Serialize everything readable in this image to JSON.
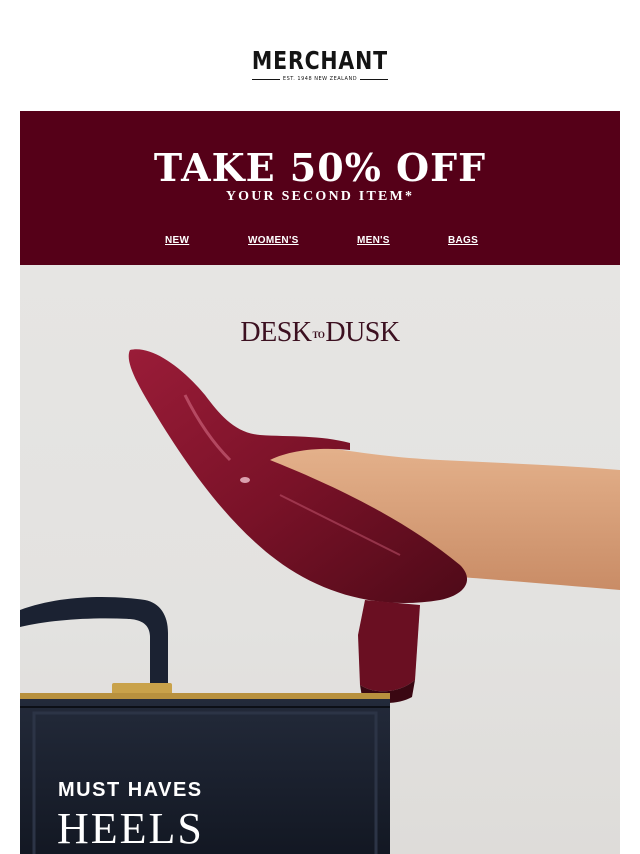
{
  "brand": {
    "logo_text": "MERCHANT",
    "logo_tagline": "EST. 1948 NEW ZEALAND"
  },
  "promo": {
    "headline": "TAKE 50% OFF",
    "subheadline": "YOUR SECOND ITEM*",
    "background_color": "#550018",
    "nav": [
      {
        "label": "NEW"
      },
      {
        "label": "WOMEN'S"
      },
      {
        "label": "MEN'S"
      },
      {
        "label": "BAGS"
      }
    ]
  },
  "hero": {
    "collection_title_left": "DESK",
    "collection_title_connector": "TO",
    "collection_title_right": "DUSK",
    "eyebrow": "MUST HAVES",
    "title": "HEELS",
    "shoe_color": "#7a1228",
    "briefcase_color": "#1a2130"
  }
}
